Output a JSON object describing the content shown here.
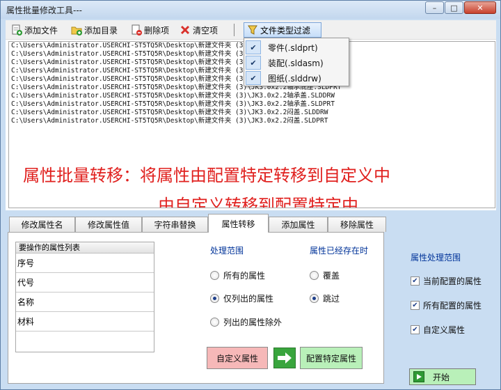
{
  "window": {
    "title": "属性批量修改工具---",
    "min_glyph": "–",
    "max_glyph": "□",
    "close_glyph": "✕"
  },
  "toolbar": {
    "add_file": "添加文件",
    "add_dir": "添加目录",
    "delete_item": "删除项",
    "clear_items": "清空项",
    "file_type_filter": "文件类型过滤"
  },
  "filter_menu": {
    "items": [
      {
        "label": "零件(.sldprt)",
        "checked": true
      },
      {
        "label": "装配(.sldasm)",
        "checked": true
      },
      {
        "label": "图纸(.slddrw)",
        "checked": true
      }
    ]
  },
  "files": [
    "C:\\Users\\Administrator.USERCHI-ST5TQ5R\\Desktop\\新建文件夹 (3)\\JK3.0x2.2轴承 .SLDDRW",
    "C:\\Users\\Administrator.USERCHI-ST5TQ5R\\Desktop\\新建文件夹 (3)\\JK3.0x2.2轴承 .SLDPRT",
    "C:\\Users\\Administrator.USERCHI-ST5TQ5R\\Desktop\\新建文件夹 (3)\\JK3.0x2.2轴承 SLDDRW",
    "C:\\Users\\Administrator.USERCHI-ST5TQ5R\\Desktop\\新建文件夹 (3)\\JK3.0x2.2轴承 .SLDPRT",
    "C:\\Users\\Administrator.USERCHI-ST5TQ5R\\Desktop\\新建文件夹 (3)\\JK3.0x2.2轴承底座.SLDDRW",
    "C:\\Users\\Administrator.USERCHI-ST5TQ5R\\Desktop\\新建文件夹 (3)\\JK3.0x2.2轴承底座.SLDPRT",
    "C:\\Users\\Administrator.USERCHI-ST5TQ5R\\Desktop\\新建文件夹 (3)\\JK3.0x2.2轴承盖.SLDDRW",
    "C:\\Users\\Administrator.USERCHI-ST5TQ5R\\Desktop\\新建文件夹 (3)\\JK3.0x2.2轴承盖.SLDPRT",
    "C:\\Users\\Administrator.USERCHI-ST5TQ5R\\Desktop\\新建文件夹 (3)\\JK3.0x2.2闷盖.SLDDRW",
    "C:\\Users\\Administrator.USERCHI-ST5TQ5R\\Desktop\\新建文件夹 (3)\\JK3.0x2.2闷盖.SLDPRT"
  ],
  "overlay_text": {
    "line1": "属性批量转移：将属性由配置特定转移到自定义中",
    "line2": "由自定义转移到配置特定中"
  },
  "tabs": [
    {
      "label": "修改属性名"
    },
    {
      "label": "修改属性值"
    },
    {
      "label": "字符串替换"
    },
    {
      "label": "属性转移",
      "active": true
    },
    {
      "label": "添加属性"
    },
    {
      "label": "移除属性"
    }
  ],
  "prop_list": {
    "header": "要操作的属性列表",
    "rows": [
      "序号",
      "代号",
      "名称",
      "材料",
      ""
    ]
  },
  "range": {
    "label": "处理范围",
    "options": [
      {
        "label": "所有的属性",
        "selected": false
      },
      {
        "label": "仅列出的属性",
        "selected": true
      },
      {
        "label": "列出的属性除外",
        "selected": false
      }
    ]
  },
  "exists": {
    "label": "属性已经存在时",
    "options": [
      {
        "label": "覆盖",
        "selected": false
      },
      {
        "label": "跳过",
        "selected": true
      }
    ]
  },
  "transfer": {
    "custom_label": "自定义属性",
    "config_label": "配置特定属性"
  },
  "scope": {
    "label": "属性处理范围",
    "items": [
      {
        "label": "当前配置的属性",
        "checked": true
      },
      {
        "label": "所有配置的属性",
        "checked": true
      },
      {
        "label": "自定义属性",
        "checked": true
      }
    ]
  },
  "start_label": "开始",
  "colors": {
    "accent_red": "#e0201e",
    "section_blue": "#003399",
    "custom_btn": "#f6b8b8",
    "config_btn": "#b9f0b9",
    "bg": "#c9ddf2"
  }
}
